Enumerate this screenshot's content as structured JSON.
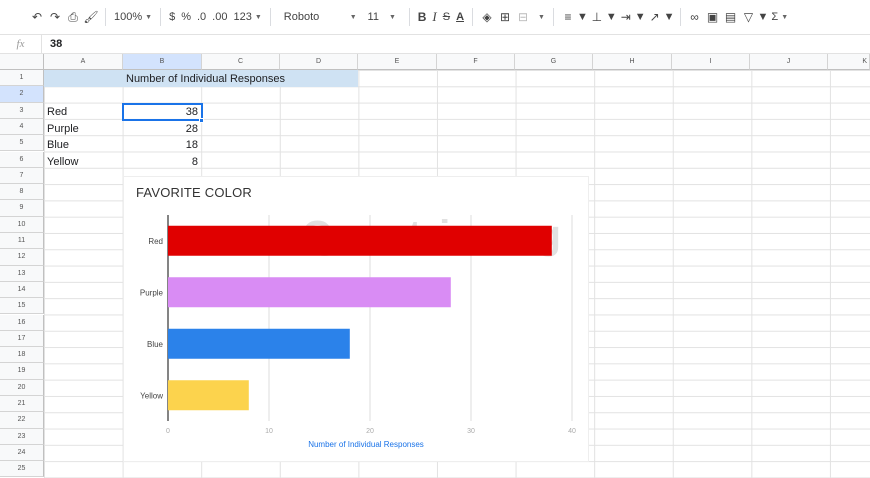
{
  "toolbar": {
    "undo_icon": "undo-icon",
    "redo_icon": "redo-icon",
    "print_icon": "print-icon",
    "paint_format_icon": "paint-format-icon",
    "zoom": "100%",
    "currency": "$",
    "percent": "%",
    "decrease_decimals": ".0",
    "increase_decimals": ".00",
    "more_formats": "123",
    "font": "Roboto",
    "font_size": "11",
    "bold": "B",
    "italic": "I",
    "strike": "S",
    "text_color": "A",
    "sigma": "Σ"
  },
  "formula_bar": {
    "fx": "fx",
    "value": "38"
  },
  "columns": [
    "A",
    "B",
    "C",
    "D",
    "E",
    "F",
    "G",
    "H",
    "I",
    "J",
    "K"
  ],
  "rows": [
    "1",
    "2",
    "3",
    "4",
    "5",
    "6",
    "7",
    "8",
    "9",
    "10",
    "11",
    "12",
    "13",
    "14",
    "15",
    "16",
    "17",
    "18",
    "19",
    "20",
    "21",
    "22",
    "23",
    "24",
    "25"
  ],
  "cells": {
    "b1": "Number of Individual Responses",
    "a2": "Red",
    "b2": "38",
    "a3": "Purple",
    "b3": "28",
    "a4": "Blue",
    "b4": "18",
    "a5": "Yellow",
    "b5": "8"
  },
  "watermark": "Quantrimang",
  "chart_data": {
    "type": "bar",
    "orientation": "horizontal",
    "title": "FAVORITE COLOR",
    "categories": [
      "Red",
      "Purple",
      "Blue",
      "Yellow"
    ],
    "values": [
      38,
      28,
      18,
      8
    ],
    "colors": [
      "#e00000",
      "#d98cf4",
      "#2b82ea",
      "#fcd34d"
    ],
    "xlabel": "Number of Individual Responses",
    "ylabel": "",
    "xlim": [
      0,
      40
    ],
    "xticks": [
      "0",
      "10",
      "20",
      "30",
      "40"
    ],
    "grid": true,
    "legend": "none"
  }
}
